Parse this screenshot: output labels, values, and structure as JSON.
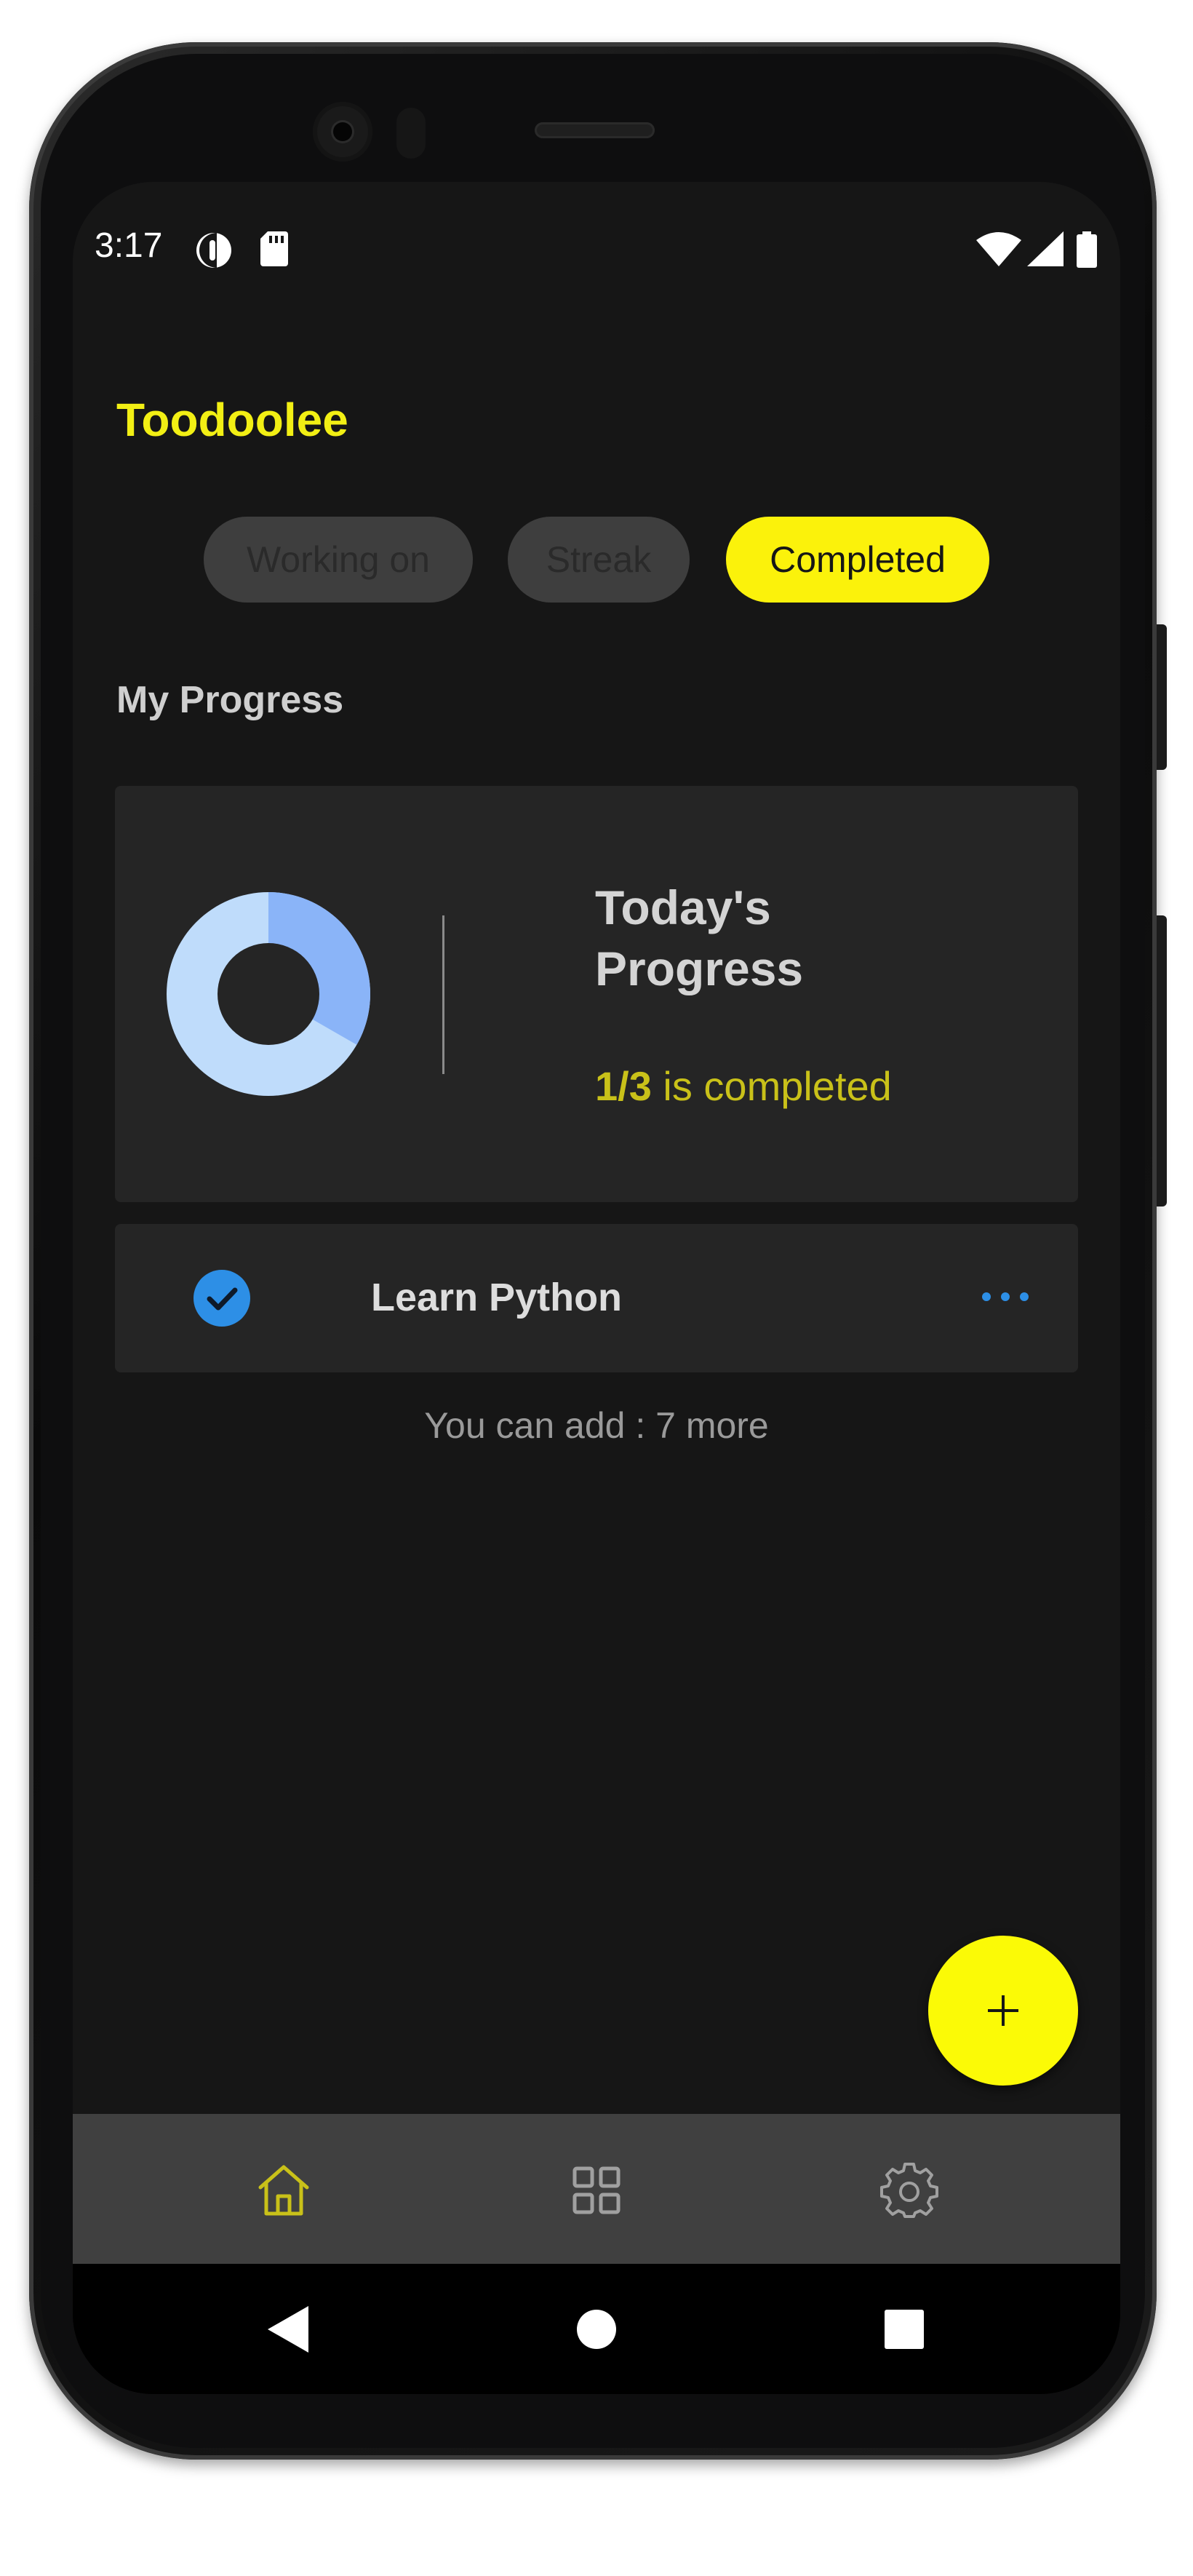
{
  "status_bar": {
    "time": "3:17"
  },
  "app": {
    "title": "Toodoolee"
  },
  "tabs": [
    {
      "label": "Working on",
      "active": false
    },
    {
      "label": "Streak",
      "active": false
    },
    {
      "label": "Completed",
      "active": true
    }
  ],
  "section": {
    "title": "My Progress"
  },
  "progress": {
    "title_line1": "Today's",
    "title_line2": "Progress",
    "completed_count": "1/3",
    "completed_suffix": " is completed",
    "completed_fraction": 0.333,
    "colors": {
      "done": "#8ab4f8",
      "remaining": "#bfdcfb"
    }
  },
  "tasks": [
    {
      "label": "Learn Python",
      "completed": true
    }
  ],
  "add_hint": "You can add : 7 more",
  "colors": {
    "accent": "#fbf20b",
    "background": "#161616",
    "card": "#252525",
    "check": "#2d8fe6"
  },
  "bottom_nav": [
    {
      "icon": "home-icon",
      "active": true
    },
    {
      "icon": "grid-icon",
      "active": false
    },
    {
      "icon": "gear-icon",
      "active": false
    }
  ],
  "system_nav": [
    "back-icon",
    "home-circle-icon",
    "recents-icon"
  ]
}
